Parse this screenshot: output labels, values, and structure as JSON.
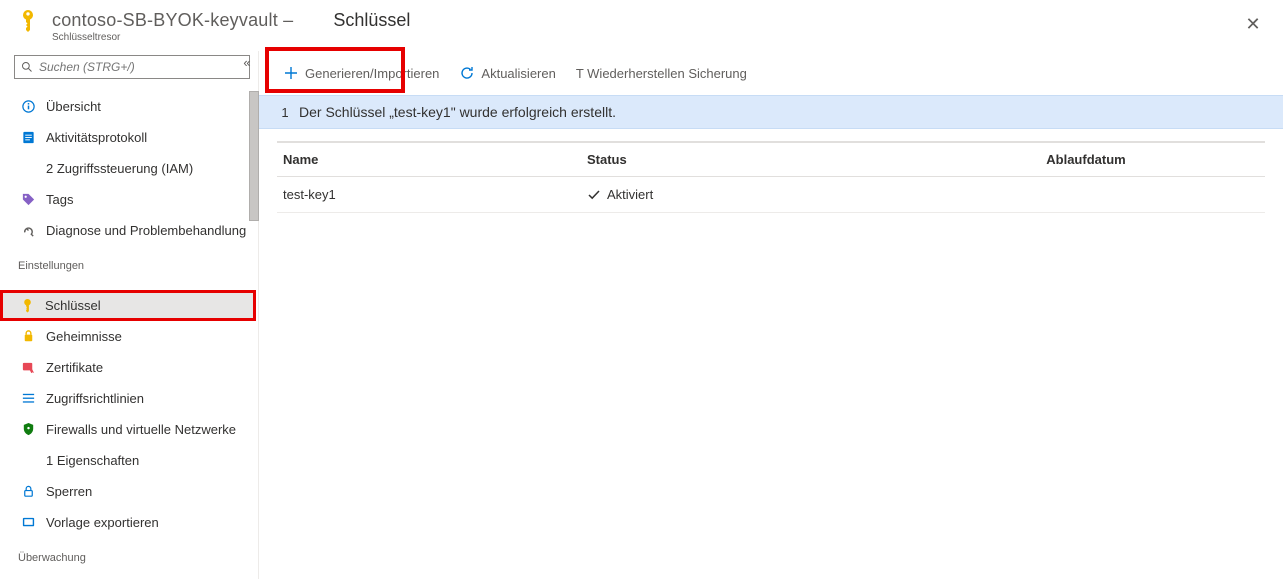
{
  "header": {
    "breadcrumb": "contoso-SB-BYOK-keyvault –",
    "resource_type": "Schlüsseltresor",
    "page_title": "Schlüssel"
  },
  "sidebar": {
    "search_placeholder": "Suchen (STRG+/)",
    "items_top": [
      {
        "label": "Übersicht",
        "icon": "info"
      },
      {
        "label": "Aktivitätsprotokoll",
        "icon": "log"
      },
      {
        "label": "2 Zugriffssteuerung (IAM)",
        "icon": "iam"
      },
      {
        "label": "Tags",
        "icon": "tag"
      },
      {
        "label": "Diagnose und Problembehandlung",
        "icon": "diag"
      }
    ],
    "group_settings": "Einstellungen",
    "items_settings": [
      {
        "label": "Schlüssel",
        "icon": "key",
        "active": true
      },
      {
        "label": "Geheimnisse",
        "icon": "secret"
      },
      {
        "label": "Zertifikate",
        "icon": "cert"
      },
      {
        "label": "Zugriffsrichtlinien",
        "icon": "policy"
      },
      {
        "label": "Firewalls und virtuelle Netzwerke",
        "icon": "fw"
      },
      {
        "label": "1 Eigenschaften",
        "icon": "props"
      },
      {
        "label": "Sperren",
        "icon": "lock"
      },
      {
        "label": "Vorlage exportieren",
        "icon": "export"
      }
    ],
    "group_monitoring": "Überwachung"
  },
  "toolbar": {
    "generate": "Generieren/Importieren",
    "refresh": "Aktualisieren",
    "restore": "T Wiederherstellen Sicherung"
  },
  "notification": {
    "count": "1",
    "text": "Der Schlüssel „test-key1\" wurde erfolgreich erstellt."
  },
  "table": {
    "col_name": "Name",
    "col_status": "Status",
    "col_exp": "Ablaufdatum",
    "rows": [
      {
        "name": "test-key1",
        "status": "Aktiviert",
        "exp": ""
      }
    ]
  }
}
